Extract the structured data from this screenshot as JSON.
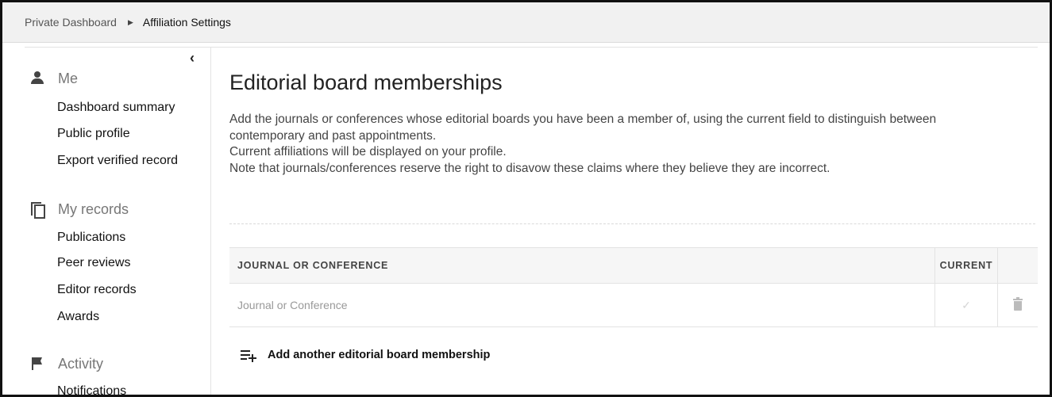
{
  "breadcrumb": {
    "parent": "Private Dashboard",
    "current": "Affiliation Settings"
  },
  "sidebar": {
    "collapse_icon": "‹",
    "sections": [
      {
        "label": "Me",
        "icon": "person-icon",
        "items": [
          "Dashboard summary",
          "Public profile",
          "Export verified record"
        ]
      },
      {
        "label": "My records",
        "icon": "copy-icon",
        "items": [
          "Publications",
          "Peer reviews",
          "Editor records",
          "Awards"
        ]
      },
      {
        "label": "Activity",
        "icon": "flag-icon",
        "items": [
          "Notifications"
        ]
      }
    ]
  },
  "main": {
    "title": "Editorial board memberships",
    "description": [
      "Add the journals or conferences whose editorial boards you have been a member of, using the current field to distinguish between contemporary and past appointments.",
      "Current affiliations will be displayed on your profile.",
      "Note that journals/conferences reserve the right to disavow these claims where they believe they are incorrect."
    ],
    "table": {
      "headers": {
        "journal": "JOURNAL OR CONFERENCE",
        "current": "CURRENT"
      },
      "rows": [
        {
          "journal_placeholder": "Journal or Conference",
          "current_mark": "✓"
        }
      ]
    },
    "add_label": "Add another editorial board membership"
  }
}
